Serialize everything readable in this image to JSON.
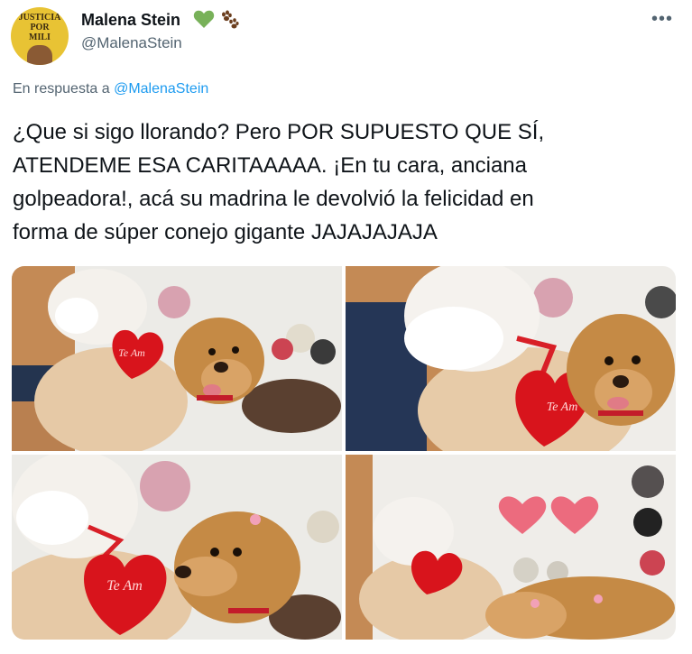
{
  "author": {
    "avatar_text": [
      "JUSTICIA",
      "POR",
      "MILI"
    ],
    "name": "Malena Stein",
    "handle": "@MalenaStein",
    "name_icons": [
      "green-heart-icon",
      "paw-prints-icon"
    ]
  },
  "reply": {
    "prefix": "En respuesta a ",
    "mention": "@MalenaStein"
  },
  "tweet": {
    "text": "¿Que si sigo llorando? Pero POR SUPUESTO QUE SÍ,\nATENDEME ESA CARITAAAAA. ¡En tu cara, anciana\ngolpeadora!, acá su madrina le devolvió la felicidad en\nforma de súper conejo gigante JAJAJAJAJA"
  },
  "photos": {
    "heart_text": "Te Am",
    "count": 4
  },
  "colors": {
    "accent": "#1d9bf0",
    "secondary_text": "#536471",
    "green_heart": "#78b159",
    "plush_heart": "#d8141c",
    "dog_fur": "#c58a45"
  },
  "icons": {
    "more": "more-options-icon"
  }
}
